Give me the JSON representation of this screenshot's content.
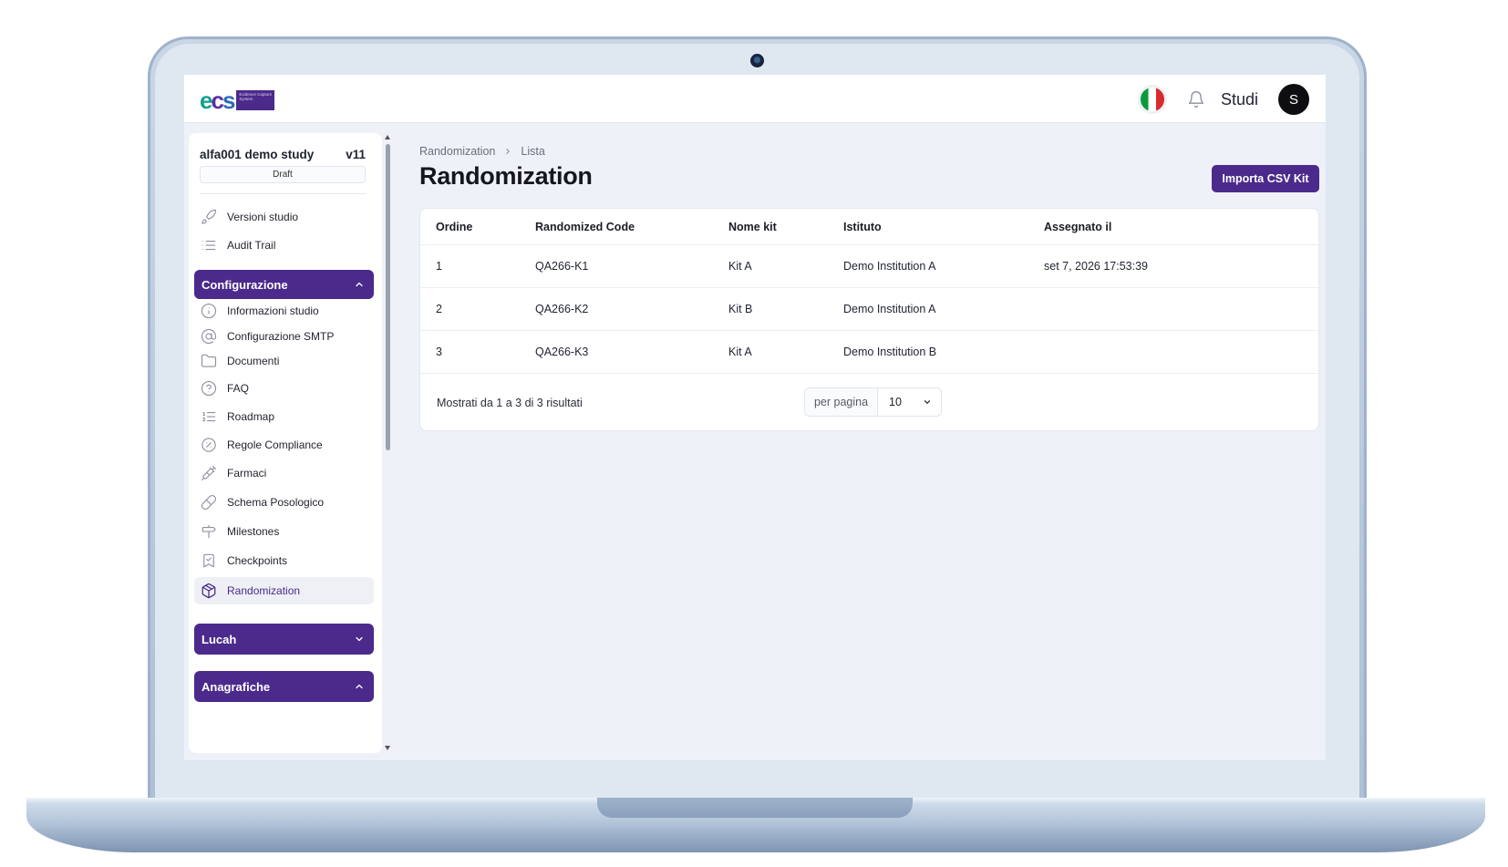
{
  "app": {
    "logo_text": "ECS",
    "logo_subtext": "Evidence Capture System"
  },
  "header": {
    "language_flag": "Italian",
    "notifications_icon": "bell-icon",
    "studi_label": "Studi",
    "avatar_initial": "S"
  },
  "sidebar": {
    "study_name": "alfa001 demo study",
    "study_version": "v11",
    "study_status": "Draft",
    "top_links": [
      {
        "label": "Versioni studio",
        "icon": "rocket-icon"
      },
      {
        "label": "Audit Trail",
        "icon": "list-icon"
      }
    ],
    "sections": [
      {
        "label": "Configurazione",
        "expanded": true,
        "items": [
          {
            "label": "Informazioni studio",
            "icon": "info-icon"
          },
          {
            "label": "Configurazione SMTP",
            "icon": "at-icon"
          },
          {
            "label": "Documenti",
            "icon": "folder-icon"
          },
          {
            "label": "FAQ",
            "icon": "help-icon"
          },
          {
            "label": "Roadmap",
            "icon": "list-ordered-icon"
          },
          {
            "label": "Regole Compliance",
            "icon": "badge-percent-icon"
          },
          {
            "label": "Farmaci",
            "icon": "syringe-icon"
          },
          {
            "label": "Schema Posologico",
            "icon": "pill-icon"
          },
          {
            "label": "Milestones",
            "icon": "signpost-icon"
          },
          {
            "label": "Checkpoints",
            "icon": "bookmark-check-icon"
          },
          {
            "label": "Randomization",
            "icon": "package-icon",
            "active": true
          }
        ]
      },
      {
        "label": "Lucah",
        "expanded": false
      },
      {
        "label": "Anagrafiche",
        "expanded": true
      }
    ]
  },
  "main": {
    "breadcrumb": [
      "Randomization",
      "Lista"
    ],
    "title": "Randomization",
    "import_button": "Importa CSV Kit",
    "table": {
      "columns": [
        "Ordine",
        "Randomized Code",
        "Nome kit",
        "Istituto",
        "Assegnato il"
      ],
      "rows": [
        [
          "1",
          "QA266-K1",
          "Kit A",
          "Demo Institution A",
          "set 7, 2026 17:53:39"
        ],
        [
          "2",
          "QA266-K2",
          "Kit B",
          "Demo Institution A",
          ""
        ],
        [
          "3",
          "QA266-K3",
          "Kit A",
          "Demo Institution B",
          ""
        ]
      ]
    },
    "footer": {
      "summary": "Mostrati da 1 a 3 di 3 risultati",
      "per_page_label": "per pagina",
      "per_page_value": "10"
    }
  },
  "colors": {
    "brand_purple": "#4b2a8c",
    "screen_bg": "#eef1f8",
    "logo_teal": "#14a08e"
  }
}
